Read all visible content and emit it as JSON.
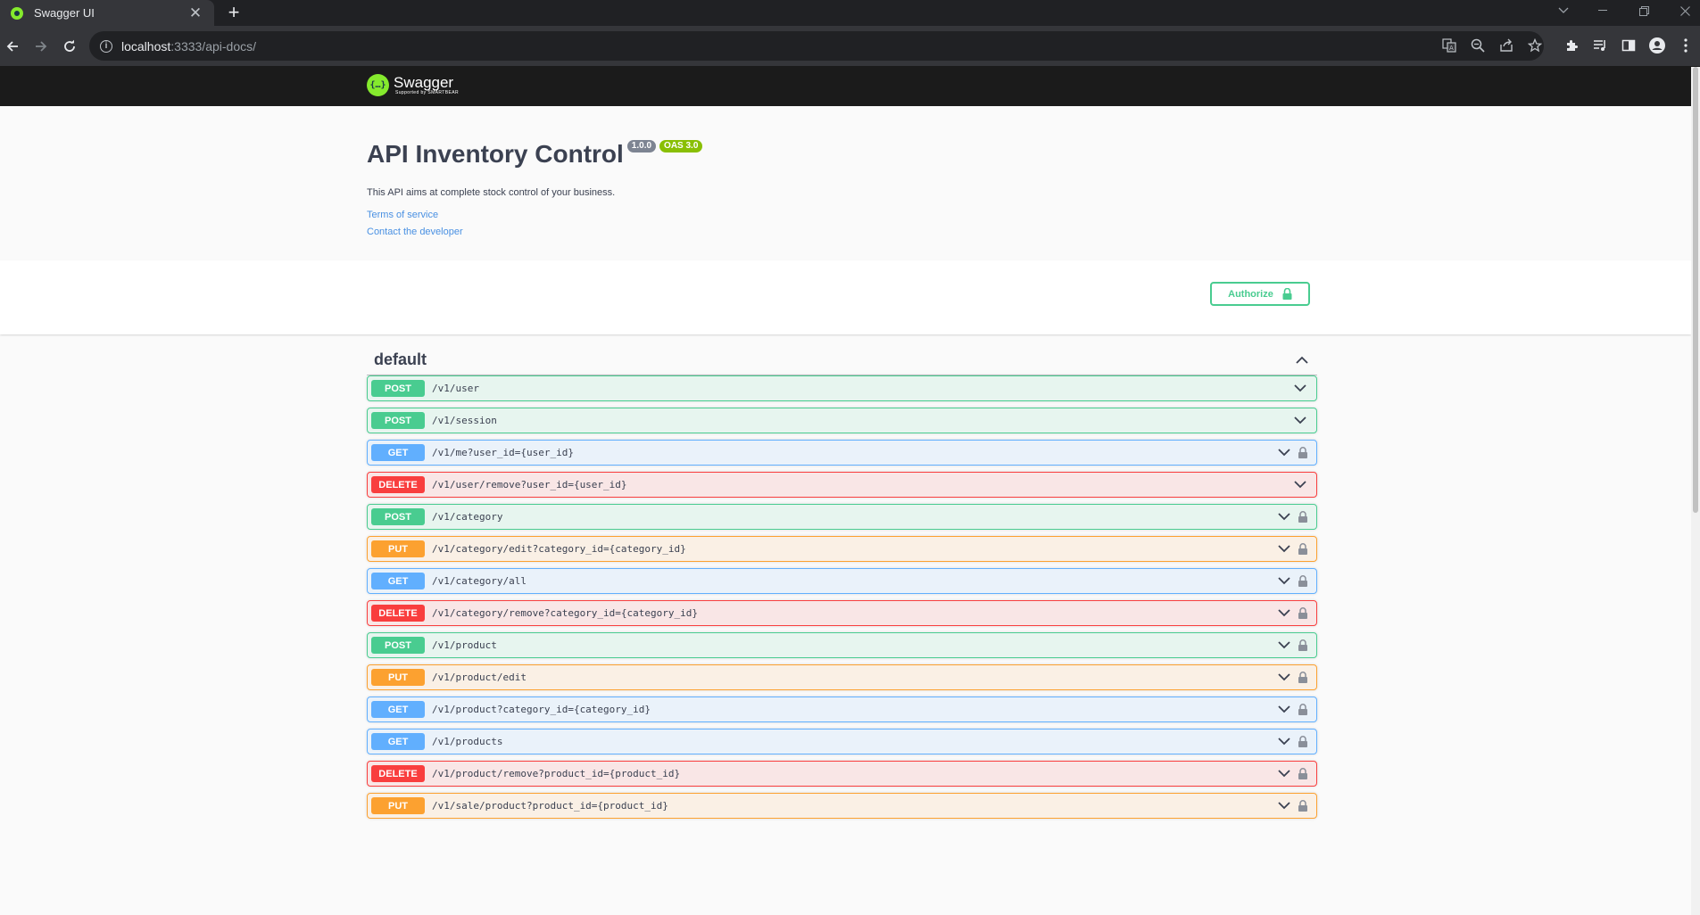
{
  "browser": {
    "tab_title": "Swagger UI",
    "tab_close": "✕",
    "new_tab": "+",
    "url_host": "localhost",
    "url_rest": ":3333/api-docs/"
  },
  "swagger": {
    "logo_name": "Swagger",
    "logo_sub": "Supported by SMARTBEAR",
    "logo_mark": "{…}"
  },
  "info": {
    "title": "API Inventory Control",
    "version": "1.0.0",
    "oas": "OAS 3.0",
    "description": "This API aims at complete stock control of your business.",
    "terms_link": "Terms of service",
    "contact_link": "Contact the developer"
  },
  "authorize": {
    "label": "Authorize"
  },
  "tag": {
    "name": "default"
  },
  "operations": [
    {
      "method": "POST",
      "path": "/v1/user",
      "locked": false
    },
    {
      "method": "POST",
      "path": "/v1/session",
      "locked": false
    },
    {
      "method": "GET",
      "path": "/v1/me?user_id={user_id}",
      "locked": true
    },
    {
      "method": "DELETE",
      "path": "/v1/user/remove?user_id={user_id}",
      "locked": false
    },
    {
      "method": "POST",
      "path": "/v1/category",
      "locked": true
    },
    {
      "method": "PUT",
      "path": "/v1/category/edit?category_id={category_id}",
      "locked": true
    },
    {
      "method": "GET",
      "path": "/v1/category/all",
      "locked": true
    },
    {
      "method": "DELETE",
      "path": "/v1/category/remove?category_id={category_id}",
      "locked": true
    },
    {
      "method": "POST",
      "path": "/v1/product",
      "locked": true
    },
    {
      "method": "PUT",
      "path": "/v1/product/edit",
      "locked": true
    },
    {
      "method": "GET",
      "path": "/v1/product?category_id={category_id}",
      "locked": true
    },
    {
      "method": "GET",
      "path": "/v1/products",
      "locked": true
    },
    {
      "method": "DELETE",
      "path": "/v1/product/remove?product_id={product_id}",
      "locked": true
    },
    {
      "method": "PUT",
      "path": "/v1/sale/product?product_id={product_id}",
      "locked": true
    }
  ],
  "colors": {
    "post": "#49cc90",
    "get": "#61affe",
    "delete": "#f93e3e",
    "put": "#fca130",
    "swagger_green": "#85ea2d"
  }
}
